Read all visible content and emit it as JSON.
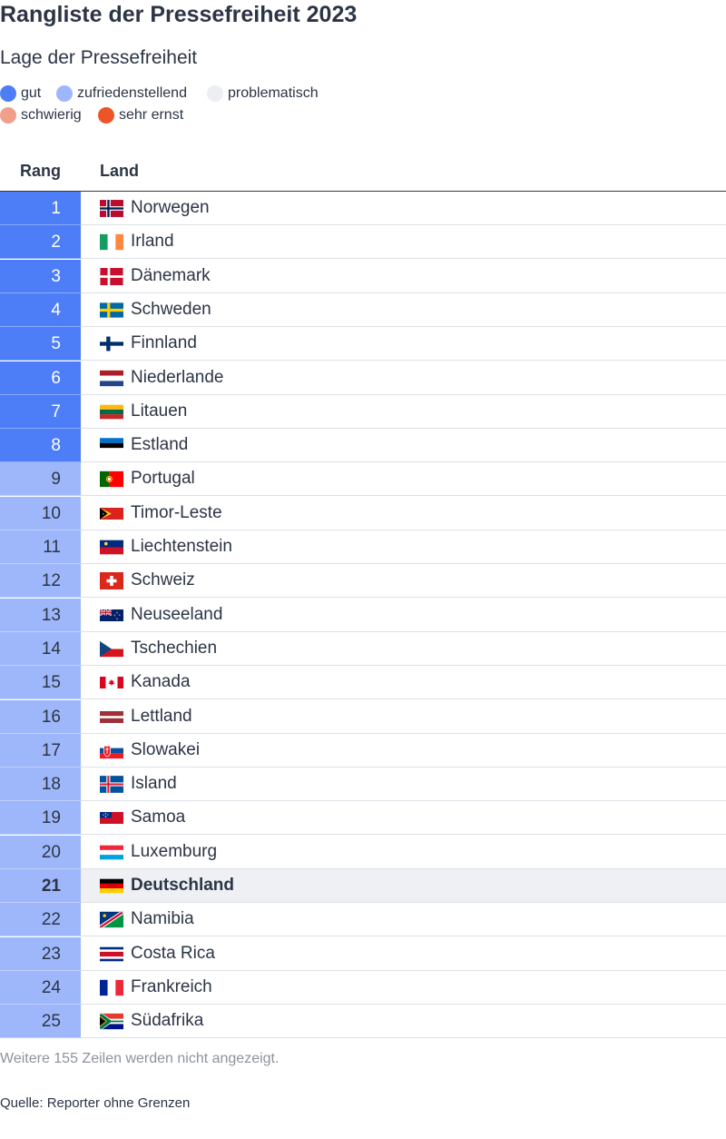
{
  "title": "Rangliste der Pressefreiheit 2023",
  "subtitle": "Lage der Pressefreiheit",
  "legend": [
    {
      "label": "gut",
      "color": "#4d7ef7"
    },
    {
      "label": "zufriedenstellend",
      "color": "#9eb7fa"
    },
    {
      "label": "problematisch",
      "color": "#eceef1"
    },
    {
      "label": "schwierig",
      "color": "#f0a08a"
    },
    {
      "label": "sehr ernst",
      "color": "#ec5528"
    }
  ],
  "columns": {
    "rank": "Rang",
    "country": "Land"
  },
  "chart_data": {
    "type": "table",
    "title": "Rangliste der Pressefreiheit 2023",
    "subtitle": "Lage der Pressefreiheit",
    "columns": [
      "Rang",
      "Land"
    ],
    "highlighted": "Deutschland",
    "rows": [
      {
        "rank": "1",
        "country": "Norwegen",
        "category": "gut",
        "flag": "no-flag-icon"
      },
      {
        "rank": "2",
        "country": "Irland",
        "category": "gut",
        "flag": "ie-flag-icon"
      },
      {
        "rank": "3",
        "country": "Dänemark",
        "category": "gut",
        "flag": "dk-flag-icon"
      },
      {
        "rank": "4",
        "country": "Schweden",
        "category": "gut",
        "flag": "se-flag-icon"
      },
      {
        "rank": "5",
        "country": "Finnland",
        "category": "gut",
        "flag": "fi-flag-icon"
      },
      {
        "rank": "6",
        "country": "Niederlande",
        "category": "gut",
        "flag": "nl-flag-icon"
      },
      {
        "rank": "7",
        "country": "Litauen",
        "category": "gut",
        "flag": "lt-flag-icon"
      },
      {
        "rank": "8",
        "country": "Estland",
        "category": "gut",
        "flag": "ee-flag-icon"
      },
      {
        "rank": "9",
        "country": "Portugal",
        "category": "zufriedenstellend",
        "flag": "pt-flag-icon"
      },
      {
        "rank": "10",
        "country": "Timor-Leste",
        "category": "zufriedenstellend",
        "flag": "tl-flag-icon"
      },
      {
        "rank": "11",
        "country": "Liechtenstein",
        "category": "zufriedenstellend",
        "flag": "li-flag-icon"
      },
      {
        "rank": "12",
        "country": "Schweiz",
        "category": "zufriedenstellend",
        "flag": "ch-flag-icon"
      },
      {
        "rank": "13",
        "country": "Neuseeland",
        "category": "zufriedenstellend",
        "flag": "nz-flag-icon"
      },
      {
        "rank": "14",
        "country": "Tschechien",
        "category": "zufriedenstellend",
        "flag": "cz-flag-icon"
      },
      {
        "rank": "15",
        "country": "Kanada",
        "category": "zufriedenstellend",
        "flag": "ca-flag-icon"
      },
      {
        "rank": "16",
        "country": "Lettland",
        "category": "zufriedenstellend",
        "flag": "lv-flag-icon"
      },
      {
        "rank": "17",
        "country": "Slowakei",
        "category": "zufriedenstellend",
        "flag": "sk-flag-icon"
      },
      {
        "rank": "18",
        "country": "Island",
        "category": "zufriedenstellend",
        "flag": "is-flag-icon"
      },
      {
        "rank": "19",
        "country": "Samoa",
        "category": "zufriedenstellend",
        "flag": "ws-flag-icon"
      },
      {
        "rank": "20",
        "country": "Luxemburg",
        "category": "zufriedenstellend",
        "flag": "lu-flag-icon"
      },
      {
        "rank": "21",
        "country": "Deutschland",
        "category": "zufriedenstellend",
        "flag": "de-flag-icon"
      },
      {
        "rank": "22",
        "country": "Namibia",
        "category": "zufriedenstellend",
        "flag": "na-flag-icon"
      },
      {
        "rank": "23",
        "country": "Costa Rica",
        "category": "zufriedenstellend",
        "flag": "cr-flag-icon"
      },
      {
        "rank": "24",
        "country": "Frankreich",
        "category": "zufriedenstellend",
        "flag": "fr-flag-icon"
      },
      {
        "rank": "25",
        "country": "Südafrika",
        "category": "zufriedenstellend",
        "flag": "za-flag-icon"
      }
    ]
  },
  "more_rows_text": "Weitere 155 Zeilen werden nicht angezeigt.",
  "source": "Quelle: Reporter ohne Grenzen"
}
